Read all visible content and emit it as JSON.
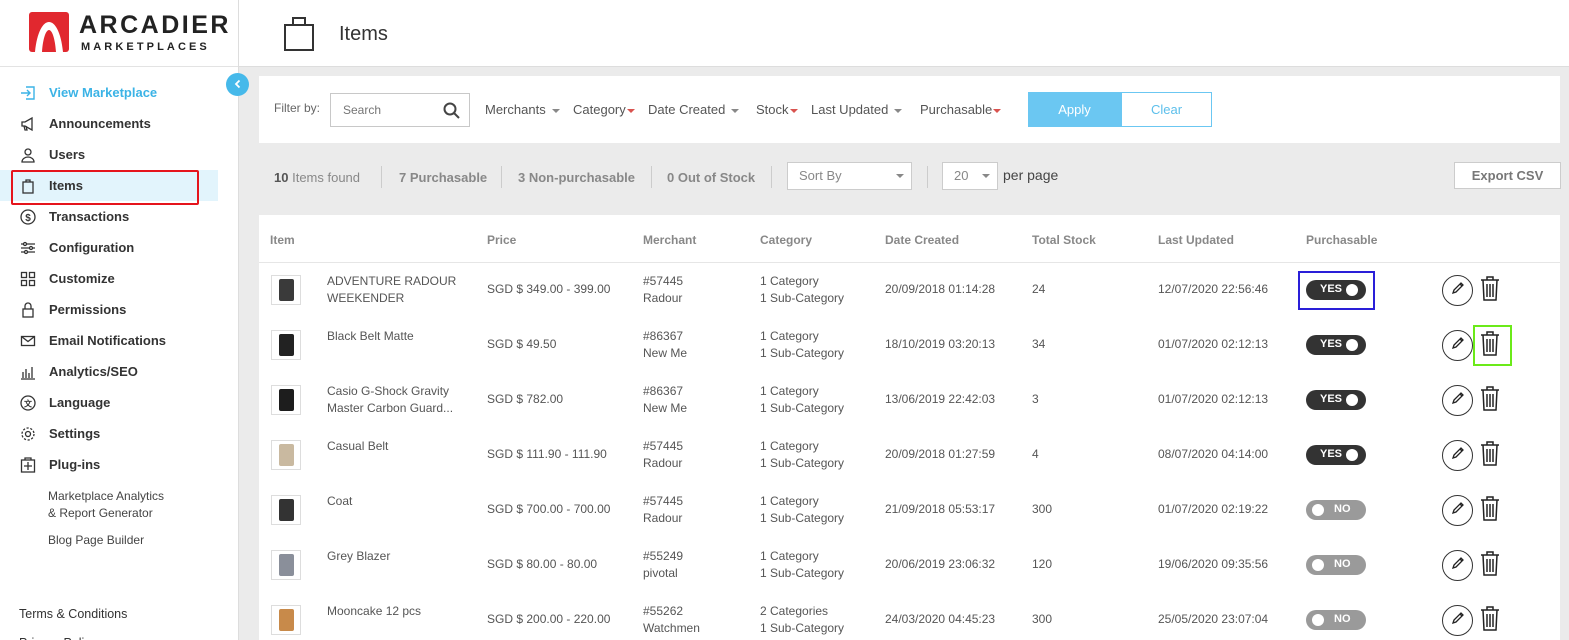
{
  "brand": {
    "name": "ARCADIER",
    "sub": "MARKETPLACES"
  },
  "colors": {
    "accent": "#46b9ea",
    "brand_red": "#e1282f",
    "toggle_on": "#333333",
    "toggle_off": "#9a9a9a"
  },
  "sidebar": {
    "items": [
      {
        "label": "View Marketplace",
        "icon": "enter-icon"
      },
      {
        "label": "Announcements",
        "icon": "megaphone-icon"
      },
      {
        "label": "Users",
        "icon": "user-icon"
      },
      {
        "label": "Items",
        "icon": "bag-icon"
      },
      {
        "label": "Transactions",
        "icon": "dollar-icon"
      },
      {
        "label": "Configuration",
        "icon": "sliders-icon"
      },
      {
        "label": "Customize",
        "icon": "grid-icon"
      },
      {
        "label": "Permissions",
        "icon": "lock-icon"
      },
      {
        "label": "Email Notifications",
        "icon": "mail-icon"
      },
      {
        "label": "Analytics/SEO",
        "icon": "bar-chart-icon"
      },
      {
        "label": "Language",
        "icon": "translate-icon"
      },
      {
        "label": "Settings",
        "icon": "gear-icon"
      },
      {
        "label": "Plug-ins",
        "icon": "plugin-icon"
      }
    ],
    "plugins": [
      "Marketplace Analytics",
      "& Report Generator",
      "Blog Page Builder"
    ],
    "footer": [
      "Terms & Conditions",
      "Privacy Policy"
    ]
  },
  "header": {
    "title": "Items"
  },
  "filters": {
    "label": "Filter by:",
    "search_placeholder": "Search",
    "merchants": "Merchants",
    "category": "Category",
    "date_created": "Date Created",
    "stock": "Stock",
    "last_updated": "Last Updated",
    "purchasable": "Purchasable",
    "apply": "Apply",
    "clear": "Clear"
  },
  "stats": {
    "found_count": "10",
    "found_label": "Items found",
    "purchasable": "7 Purchasable",
    "non_purchasable": "3 Non-purchasable",
    "out_of_stock": "0 Out of Stock",
    "sort_by": "Sort By",
    "per_page_value": "20",
    "per_page_label": "per page",
    "export": "Export CSV"
  },
  "table": {
    "headers": [
      "Item",
      "Price",
      "Merchant",
      "Category",
      "Date Created",
      "Total Stock",
      "Last Updated",
      "Purchasable"
    ],
    "rows": [
      {
        "name1": "ADVENTURE RADOUR",
        "name2": "WEEKENDER",
        "price": "SGD $ 349.00 - 399.00",
        "merchant_id": "#57445",
        "merchant_name": "Radour",
        "cat1": "1 Category",
        "cat2": "1 Sub-Category",
        "created": "20/09/2018 01:14:28",
        "stock": "24",
        "updated": "12/07/2020 22:56:46",
        "purchasable": "YES"
      },
      {
        "name1": "Black Belt Matte",
        "name2": "",
        "price": "SGD $ 49.50",
        "merchant_id": "#86367",
        "merchant_name": "New Me",
        "cat1": "1 Category",
        "cat2": "1 Sub-Category",
        "created": "18/10/2019 03:20:13",
        "stock": "34",
        "updated": "01/07/2020 02:12:13",
        "purchasable": "YES"
      },
      {
        "name1": "Casio G-Shock Gravity",
        "name2": "Master Carbon Guard...",
        "price": "SGD $ 782.00",
        "merchant_id": "#86367",
        "merchant_name": "New Me",
        "cat1": "1 Category",
        "cat2": "1 Sub-Category",
        "created": "13/06/2019 22:42:03",
        "stock": "3",
        "updated": "01/07/2020 02:12:13",
        "purchasable": "YES"
      },
      {
        "name1": "Casual Belt",
        "name2": "",
        "price": "SGD $ 111.90 - 111.90",
        "merchant_id": "#57445",
        "merchant_name": "Radour",
        "cat1": "1 Category",
        "cat2": "1 Sub-Category",
        "created": "20/09/2018 01:27:59",
        "stock": "4",
        "updated": "08/07/2020 04:14:00",
        "purchasable": "YES"
      },
      {
        "name1": "Coat",
        "name2": "",
        "price": "SGD $ 700.00 - 700.00",
        "merchant_id": "#57445",
        "merchant_name": "Radour",
        "cat1": "1 Category",
        "cat2": "1 Sub-Category",
        "created": "21/09/2018 05:53:17",
        "stock": "300",
        "updated": "01/07/2020 02:19:22",
        "purchasable": "NO"
      },
      {
        "name1": "Grey Blazer",
        "name2": "",
        "price": "SGD $ 80.00 - 80.00",
        "merchant_id": "#55249",
        "merchant_name": "pivotal",
        "cat1": "1 Category",
        "cat2": "1 Sub-Category",
        "created": "20/06/2019 23:06:32",
        "stock": "120",
        "updated": "19/06/2020 09:35:56",
        "purchasable": "NO"
      },
      {
        "name1": "Mooncake 12 pcs",
        "name2": "",
        "price": "SGD $ 200.00 - 220.00",
        "merchant_id": "#55262",
        "merchant_name": "Watchmen",
        "cat1": "2 Categories",
        "cat2": "1 Sub-Category",
        "created": "24/03/2020 04:45:23",
        "stock": "300",
        "updated": "25/05/2020 23:07:04",
        "purchasable": "NO"
      }
    ]
  }
}
